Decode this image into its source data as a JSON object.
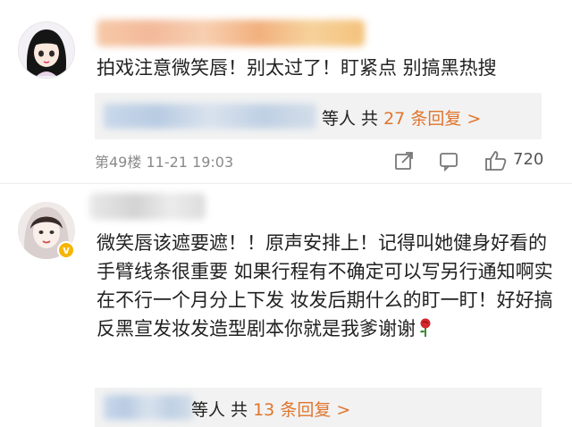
{
  "comments": [
    {
      "text": "拍戏注意微笑唇！别太过了！盯紧点 别搞黑热搜",
      "replies": {
        "prefix": "等人 共",
        "count": "27",
        "suffix": "条回复 >"
      },
      "floor": "第49楼",
      "time": "11-21 19:03",
      "likes": "720",
      "icons": [
        "share-icon",
        "comment-icon",
        "like-icon"
      ]
    },
    {
      "text": "微笑唇该遮要遮！！原声安排上！记得叫她健身好看的手臂线条很重要 如果行程有不确定可以写另行通知啊实在不行一个月分上下发 妆发后期什么的盯一盯！好好搞反黑宣发妆发造型剧本你就是我爹谢谢",
      "emoji": "rose-icon",
      "replies": {
        "prefix": "等人 共",
        "count": "13",
        "suffix": "条回复 >"
      },
      "verified_icon": "verified-badge-icon"
    }
  ],
  "colors": {
    "accent": "#e0752c",
    "reply_bg": "#f2f2f2",
    "meta": "#8a8a8a"
  }
}
